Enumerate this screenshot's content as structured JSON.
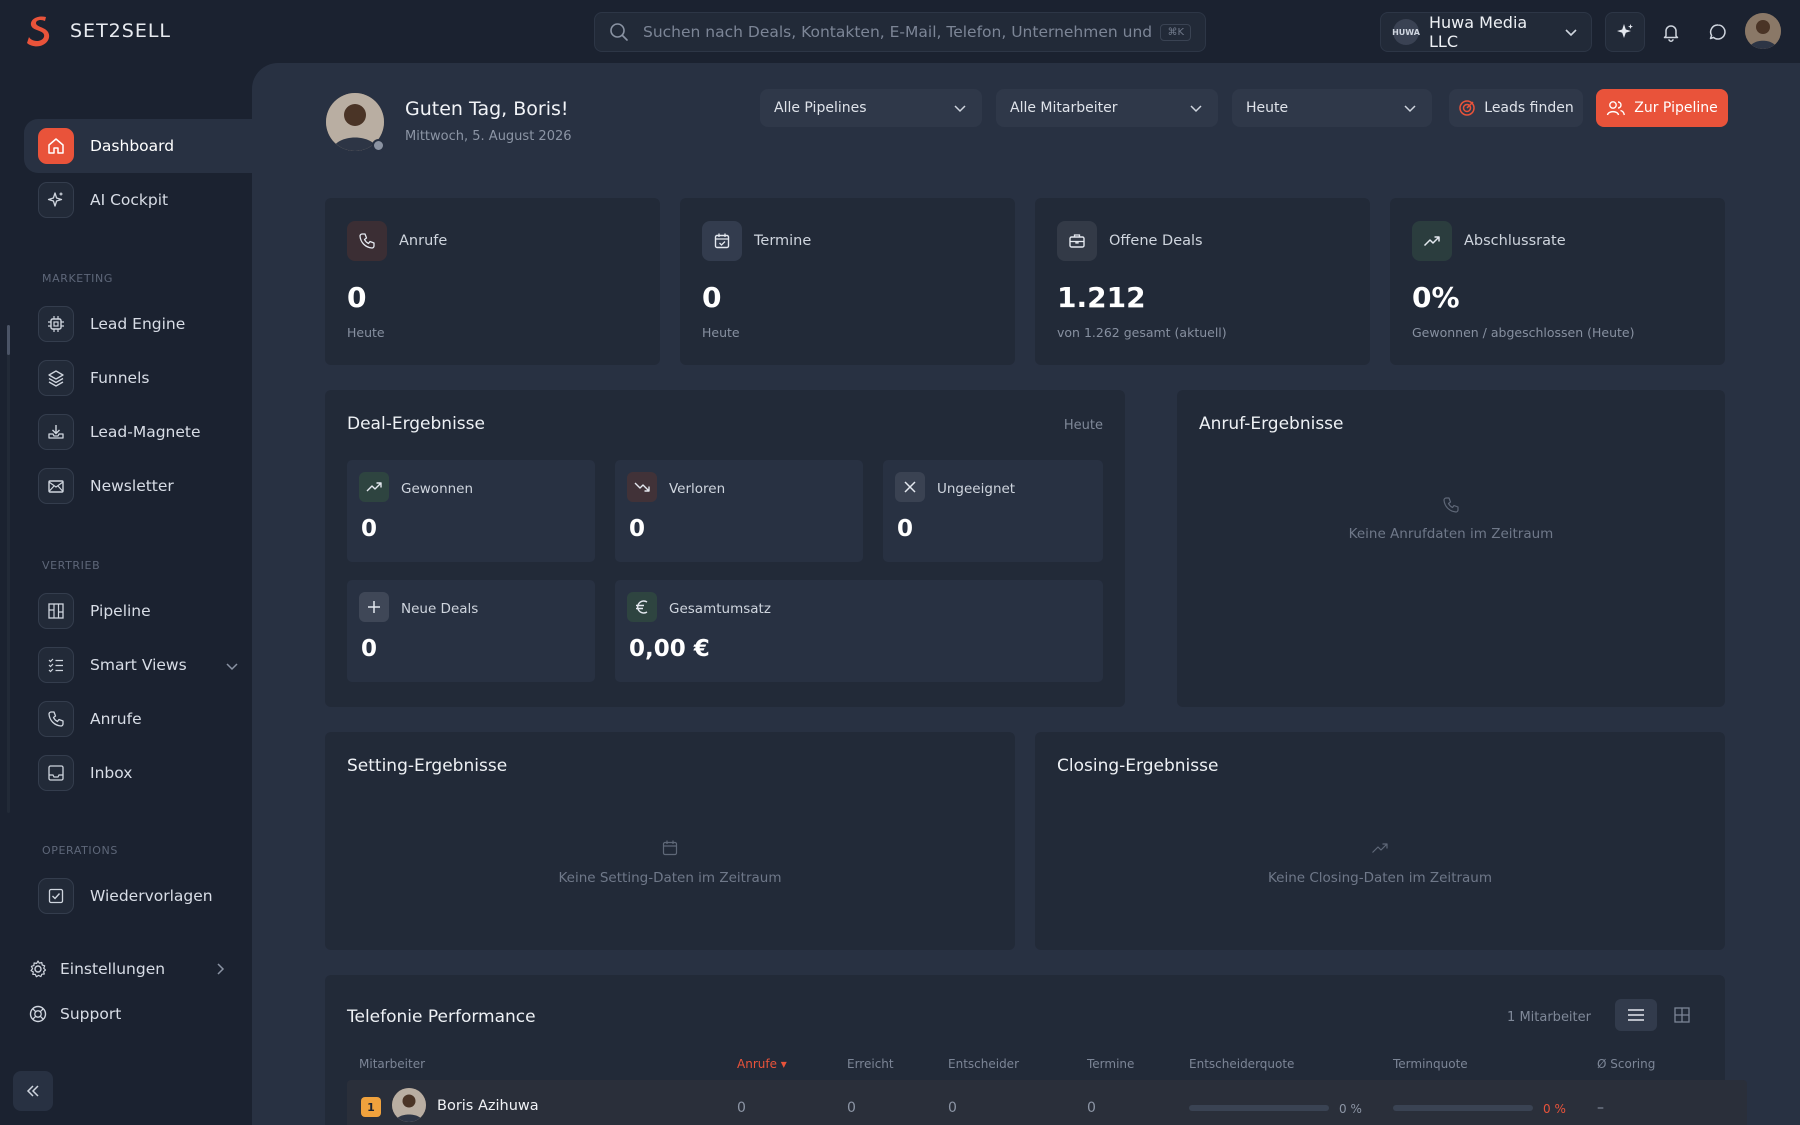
{
  "app": {
    "name": "SET2SELL",
    "brand_color": "#e9533a"
  },
  "search": {
    "placeholder": "Suchen nach Deals, Kontakten, E-Mail, Telefon, Unternehmen und Fun",
    "shortcut": "⌘K"
  },
  "org": {
    "name": "Huwa Media LLC",
    "logo_text": "HUWA"
  },
  "sidebar": {
    "items": [
      {
        "label": "Dashboard",
        "icon": "home-icon",
        "active": true
      },
      {
        "label": "AI Cockpit",
        "icon": "sparkle-icon"
      }
    ],
    "sections": [
      {
        "label": "MARKETING",
        "items": [
          {
            "label": "Lead Engine",
            "icon": "chip-icon"
          },
          {
            "label": "Funnels",
            "icon": "layers-icon"
          },
          {
            "label": "Lead-Magnete",
            "icon": "download-tray-icon"
          },
          {
            "label": "Newsletter",
            "icon": "mail-icon"
          }
        ]
      },
      {
        "label": "VERTRIEB",
        "items": [
          {
            "label": "Pipeline",
            "icon": "kanban-icon"
          },
          {
            "label": "Smart Views",
            "icon": "checklist-icon"
          },
          {
            "label": "Anrufe",
            "icon": "phone-icon"
          },
          {
            "label": "Inbox",
            "icon": "inbox-icon"
          }
        ]
      },
      {
        "label": "OPERATIONS",
        "items": [
          {
            "label": "Wiedervorlagen",
            "icon": "checkbox-icon"
          }
        ]
      }
    ],
    "footer": {
      "settings": "Einstellungen",
      "support": "Support"
    }
  },
  "header": {
    "greeting": "Guten Tag, Boris!",
    "date": "Mittwoch, 5. August 2026",
    "filters": {
      "pipelines": "Alle Pipelines",
      "employees": "Alle Mitarbeiter",
      "period": "Heute"
    },
    "leads_button": "Leads finden",
    "pipeline_button": "Zur Pipeline"
  },
  "stats": [
    {
      "label": "Anrufe",
      "value": "0",
      "sub": "Heute",
      "icon": "phone-icon",
      "color": "#e9533a"
    },
    {
      "label": "Termine",
      "value": "0",
      "sub": "Heute",
      "icon": "calendar-icon",
      "color": "#6b8fd6"
    },
    {
      "label": "Offene Deals",
      "value": "1.212",
      "sub": "von 1.262 gesamt (aktuell)",
      "icon": "briefcase-icon",
      "color": "#aab2c0"
    },
    {
      "label": "Abschlussrate",
      "value": "0%",
      "sub": "Gewonnen / abgeschlossen (Heute)",
      "icon": "trend-up-icon",
      "color": "#3fb27f"
    }
  ],
  "deal_results": {
    "title": "Deal-Ergebnisse",
    "period": "Heute",
    "items": [
      {
        "label": "Gewonnen",
        "value": "0",
        "icon": "trend-up-icon"
      },
      {
        "label": "Verloren",
        "value": "0",
        "icon": "trend-down-icon"
      },
      {
        "label": "Ungeeignet",
        "value": "0",
        "icon": "close-icon"
      },
      {
        "label": "Neue Deals",
        "value": "0",
        "icon": "plus-icon"
      },
      {
        "label": "Gesamtumsatz",
        "value": "0,00 €",
        "icon": "euro-icon"
      }
    ]
  },
  "call_results": {
    "title": "Anruf-Ergebnisse",
    "empty": "Keine Anrufdaten im Zeitraum"
  },
  "setting_results": {
    "title": "Setting-Ergebnisse",
    "empty": "Keine Setting-Daten im Zeitraum"
  },
  "closing_results": {
    "title": "Closing-Ergebnisse",
    "empty": "Keine Closing-Daten im Zeitraum"
  },
  "telephony": {
    "title": "Telefonie Performance",
    "count": "1 Mitarbeiter",
    "columns": [
      "Mitarbeiter",
      "Anrufe ▾",
      "Erreicht",
      "Entscheider",
      "Termine",
      "Entscheiderquote",
      "Terminquote",
      "Ø Scoring"
    ],
    "rows": [
      {
        "rank": "1",
        "name": "Boris Azihuwa",
        "calls": "0",
        "reached": "0",
        "deciders": "0",
        "appointments": "0",
        "decider_rate": "0 %",
        "decider_rate_value": 0,
        "appointment_rate": "0 %",
        "appointment_rate_value": 0,
        "scoring": "–"
      }
    ]
  }
}
